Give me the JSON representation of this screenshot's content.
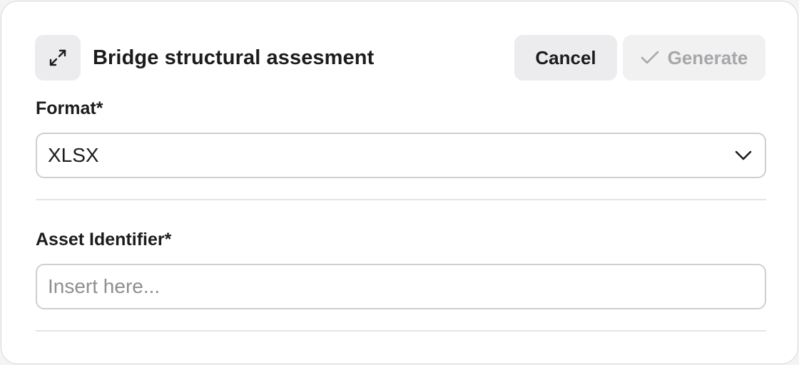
{
  "dialog": {
    "title": "Bridge structural assesment",
    "cancel_label": "Cancel",
    "generate_label": "Generate",
    "expand_icon": "expand-arrows-icon",
    "generate_icon": "check-icon"
  },
  "format_field": {
    "label": "Format*",
    "value": "XLSX",
    "icon": "chevron-down-icon"
  },
  "asset_field": {
    "label": "Asset Identifier*",
    "placeholder": "Insert here...",
    "value": ""
  },
  "colors": {
    "button_bg": "#ececee",
    "disabled_text": "#a7a7aa",
    "border": "#cfcfd1",
    "text": "#1c1c1e"
  }
}
